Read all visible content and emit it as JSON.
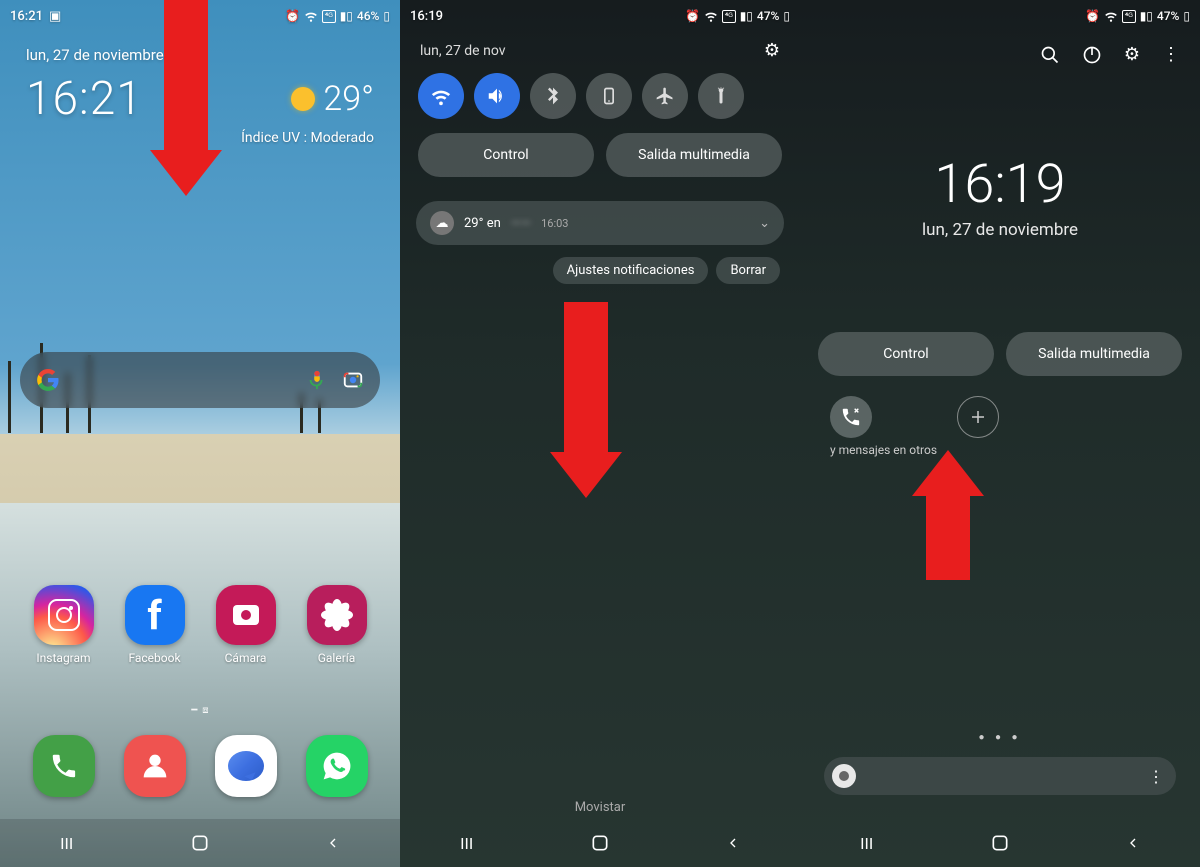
{
  "panel1": {
    "status": {
      "time": "16:21",
      "battery": "46%"
    },
    "date": "lun, 27 de noviembre",
    "clock": "16:21",
    "temp": "29°",
    "uv": "Índice UV : Moderado",
    "apps": [
      {
        "label": "Instagram"
      },
      {
        "label": "Facebook"
      },
      {
        "label": "Cámara"
      },
      {
        "label": "Galería"
      }
    ]
  },
  "panel2": {
    "status": {
      "time": "16:19",
      "battery": "47%"
    },
    "date": "lun, 27 de nov",
    "pills": {
      "control": "Control",
      "media": "Salida multimedia"
    },
    "notif": {
      "temp": "29° en",
      "loc": "——",
      "time": "16:03"
    },
    "chips": {
      "settings": "Ajustes notificaciones",
      "clear": "Borrar"
    },
    "carrier": "Movistar"
  },
  "panel3": {
    "status": {
      "battery": "47%"
    },
    "clock": "16:19",
    "date": "lun, 27 de noviembre",
    "pills": {
      "control": "Control",
      "media": "Salida multimedia"
    },
    "device_label": "y mensajes en otros"
  }
}
